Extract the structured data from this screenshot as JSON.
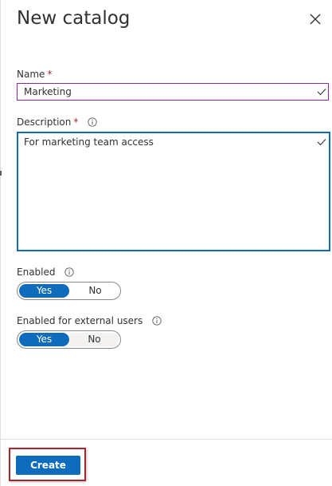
{
  "panel": {
    "title": "New catalog"
  },
  "form": {
    "name": {
      "label": "Name",
      "required_mark": "*",
      "value": "Marketing"
    },
    "description": {
      "label": "Description",
      "required_mark": "*",
      "value": "For marketing team access"
    },
    "enabled": {
      "label": "Enabled",
      "options": [
        "Yes",
        "No"
      ],
      "selected": "Yes"
    },
    "enabled_external": {
      "label": "Enabled for external users",
      "options": [
        "Yes",
        "No"
      ],
      "selected": "Yes"
    }
  },
  "footer": {
    "create_label": "Create"
  },
  "icons": {
    "close": "close-icon",
    "info": "info-icon",
    "check": "check-icon"
  },
  "colors": {
    "accent": "#0f6cbd",
    "required": "#a4262c",
    "name_input_border": "#8a2a9b",
    "highlight_border": "#a4262c"
  }
}
